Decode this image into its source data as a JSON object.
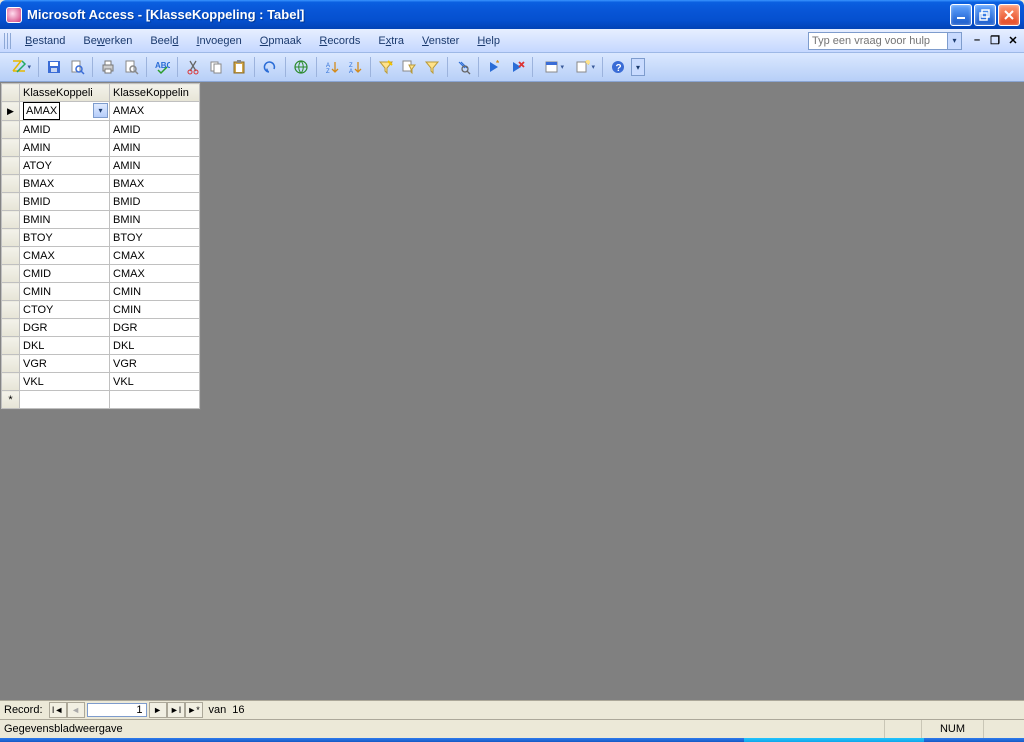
{
  "title": "Microsoft Access - [KlasseKoppeling : Tabel]",
  "menu": {
    "bestand": "Bestand",
    "bewerken": "Bewerken",
    "beeld": "Beeld",
    "invoegen": "Invoegen",
    "opmaak": "Opmaak",
    "records": "Records",
    "extra": "Extra",
    "venster": "Venster",
    "help": "Help"
  },
  "helpbox_placeholder": "Typ een vraag voor hulp",
  "table": {
    "headers": {
      "col1": "KlasseKoppeli",
      "col2": "KlasseKoppelin"
    },
    "rows": [
      {
        "c1": "AMAX",
        "c2": "AMAX"
      },
      {
        "c1": "AMID",
        "c2": "AMID"
      },
      {
        "c1": "AMIN",
        "c2": "AMIN"
      },
      {
        "c1": "ATOY",
        "c2": "AMIN"
      },
      {
        "c1": "BMAX",
        "c2": "BMAX"
      },
      {
        "c1": "BMID",
        "c2": "BMID"
      },
      {
        "c1": "BMIN",
        "c2": "BMIN"
      },
      {
        "c1": "BTOY",
        "c2": "BTOY"
      },
      {
        "c1": "CMAX",
        "c2": "CMAX"
      },
      {
        "c1": "CMID",
        "c2": "CMAX"
      },
      {
        "c1": "CMIN",
        "c2": "CMIN"
      },
      {
        "c1": "CTOY",
        "c2": "CMIN"
      },
      {
        "c1": "DGR",
        "c2": "DGR"
      },
      {
        "c1": "DKL",
        "c2": "DKL"
      },
      {
        "c1": "VGR",
        "c2": "VGR"
      },
      {
        "c1": "VKL",
        "c2": "VKL"
      }
    ]
  },
  "recordnav": {
    "label": "Record:",
    "current": "1",
    "of_label": "van",
    "total": "16"
  },
  "status": {
    "mode": "Gegevensbladweergave",
    "num": "NUM"
  }
}
